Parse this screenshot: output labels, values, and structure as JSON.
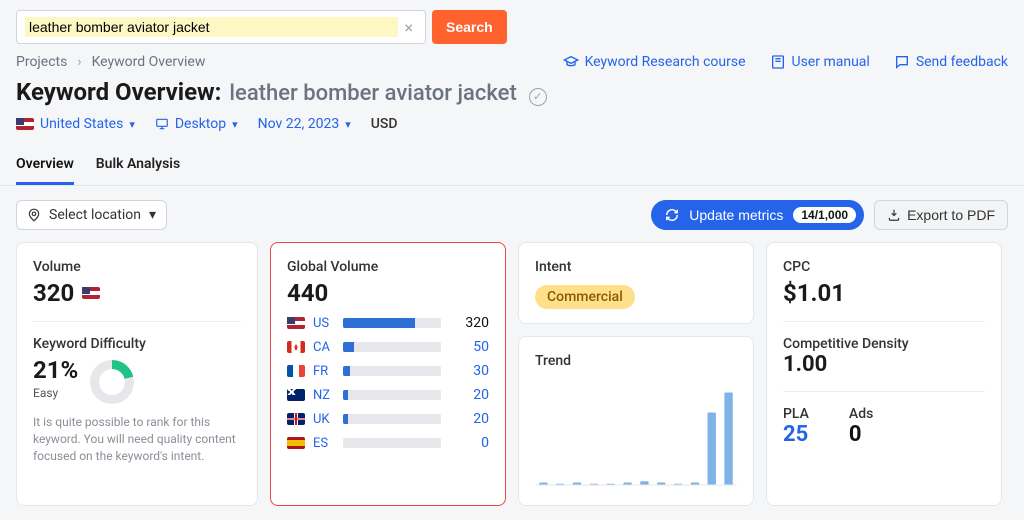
{
  "search": {
    "value": "leather bomber aviator jacket",
    "button": "Search"
  },
  "breadcrumb": {
    "root": "Projects",
    "page": "Keyword Overview"
  },
  "header_links": {
    "course": "Keyword Research course",
    "manual": "User manual",
    "feedback": "Send feedback"
  },
  "title": {
    "heading": "Keyword Overview:",
    "keyword": "leather bomber aviator jacket"
  },
  "filters": {
    "country": "United States",
    "device": "Desktop",
    "date": "Nov 22, 2023",
    "currency": "USD"
  },
  "tabs": {
    "overview": "Overview",
    "bulk": "Bulk Analysis"
  },
  "toolbar": {
    "select_location": "Select location",
    "update": "Update metrics",
    "update_count": "14/1,000",
    "export": "Export to PDF"
  },
  "volume_card": {
    "label": "Volume",
    "value": "320",
    "kd_label": "Keyword Difficulty",
    "kd_value": "21%",
    "kd_easy": "Easy",
    "kd_note": "It is quite possible to rank for this keyword. You will need quality content focused on the keyword's intent."
  },
  "global_volume": {
    "label": "Global Volume",
    "total": "440",
    "rows": [
      {
        "flag": "us",
        "cc": "US",
        "value": "320",
        "pct": 73,
        "dark": true
      },
      {
        "flag": "ca",
        "cc": "CA",
        "value": "50",
        "pct": 11
      },
      {
        "flag": "fr",
        "cc": "FR",
        "value": "30",
        "pct": 7
      },
      {
        "flag": "nz",
        "cc": "NZ",
        "value": "20",
        "pct": 5
      },
      {
        "flag": "uk",
        "cc": "UK",
        "value": "20",
        "pct": 5
      },
      {
        "flag": "es",
        "cc": "ES",
        "value": "0",
        "pct": 0
      }
    ]
  },
  "intent": {
    "label": "Intent",
    "value": "Commercial"
  },
  "trend": {
    "label": "Trend"
  },
  "cpc": {
    "label": "CPC",
    "value": "$1.01",
    "cd_label": "Competitive Density",
    "cd_value": "1.00",
    "pla_label": "PLA",
    "pla_value": "25",
    "ads_label": "Ads",
    "ads_value": "0"
  },
  "chart_data": {
    "type": "bar",
    "title": "Trend",
    "xlabel": "",
    "ylabel": "",
    "values": [
      2,
      1,
      2,
      1,
      1,
      2,
      3,
      2,
      1,
      2,
      58,
      74
    ],
    "ylim": [
      0,
      80
    ]
  }
}
